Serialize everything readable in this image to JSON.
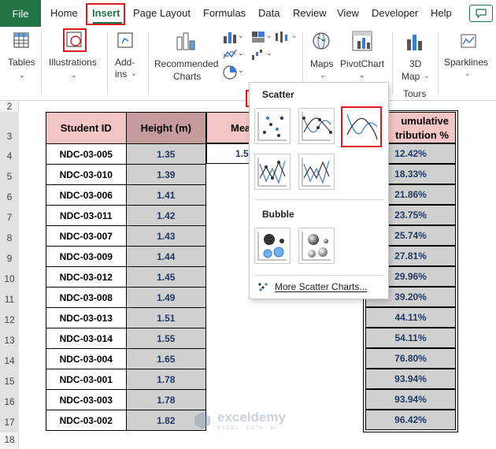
{
  "tabs": {
    "file": "File",
    "home": "Home",
    "insert": "Insert",
    "page_layout": "Page Layout",
    "formulas": "Formulas",
    "data": "Data",
    "review": "Review",
    "view": "View",
    "developer": "Developer",
    "help": "Help"
  },
  "ribbon": {
    "tables": "Tables",
    "illustrations": "Illustrations",
    "addins_1": "Add-",
    "addins_2": "ins",
    "recommended_1": "Recommended",
    "recommended_2": "Charts",
    "maps": "Maps",
    "pivotchart": "PivotChart",
    "map3d_1": "3D",
    "map3d_2": "Map",
    "tours": "Tours",
    "sparklines": "Sparklines"
  },
  "row_numbers": [
    "2",
    "3",
    "4",
    "5",
    "6",
    "7",
    "8",
    "9",
    "10",
    "11",
    "12",
    "13",
    "14",
    "15",
    "16",
    "17",
    "18"
  ],
  "table": {
    "header_id": "Student ID",
    "header_height": "Height (m)",
    "header_mean": "Mea",
    "mean_value": "1.5",
    "header_cum_1": "umulative",
    "header_cum_2": "tribution %",
    "rows": [
      {
        "id": "NDC-03-005",
        "height": "1.35",
        "cum": "12.42%"
      },
      {
        "id": "NDC-03-010",
        "height": "1.39",
        "cum": "18.33%"
      },
      {
        "id": "NDC-03-006",
        "height": "1.41",
        "cum": "21.86%"
      },
      {
        "id": "NDC-03-011",
        "height": "1.42",
        "cum": "23.75%"
      },
      {
        "id": "NDC-03-007",
        "height": "1.43",
        "cum": "25.74%"
      },
      {
        "id": "NDC-03-009",
        "height": "1.44",
        "cum": "27.81%"
      },
      {
        "id": "NDC-03-012",
        "height": "1.45",
        "cum": "29.96%"
      },
      {
        "id": "NDC-03-008",
        "height": "1.49",
        "cum": "39.20%"
      },
      {
        "id": "NDC-03-013",
        "height": "1.51",
        "cum": "44.11%"
      },
      {
        "id": "NDC-03-014",
        "height": "1.55",
        "cum": "54.11%"
      },
      {
        "id": "NDC-03-004",
        "height": "1.65",
        "cum": "76.80%"
      },
      {
        "id": "NDC-03-001",
        "height": "1.78",
        "cum": "93.94%"
      },
      {
        "id": "NDC-03-003",
        "height": "1.78",
        "cum": "93.94%"
      },
      {
        "id": "NDC-03-002",
        "height": "1.82",
        "cum": "96.42%"
      }
    ]
  },
  "dropdown": {
    "scatter_heading": "Scatter",
    "bubble_heading": "Bubble",
    "more": "More Scatter Charts..."
  },
  "watermark": {
    "name": "exceldemy",
    "tagline": "EXCEL · DATA · BI"
  },
  "colors": {
    "excel_green": "#217346",
    "highlight_red": "#e0191e",
    "header_pink": "#f2c4c4",
    "header_dark_pink": "#c59b9b",
    "cell_gray": "#d0d0d0",
    "value_blue": "#1f3864"
  }
}
